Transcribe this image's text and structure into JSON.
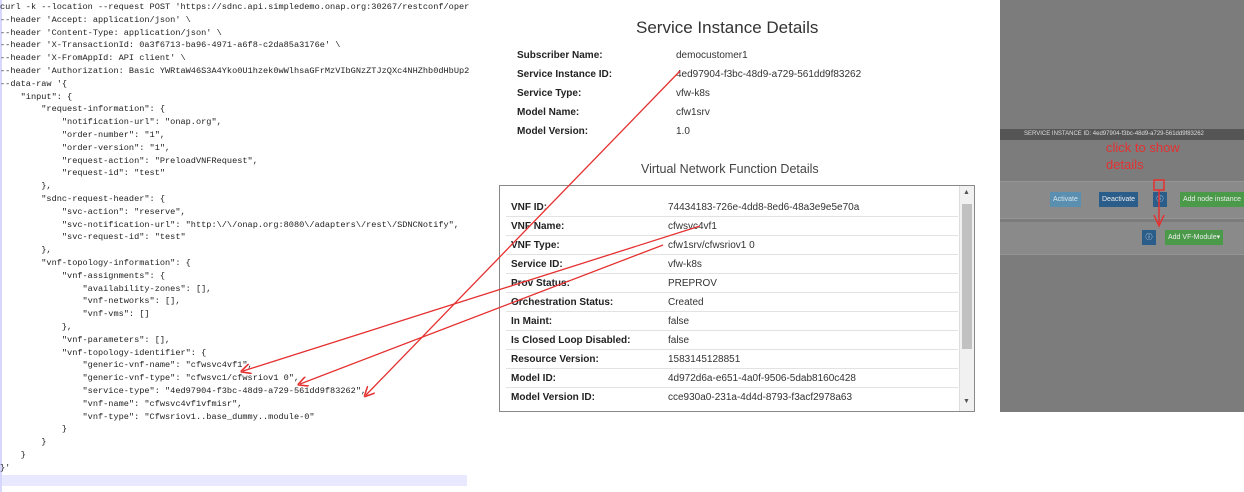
{
  "code_lines": [
    "curl -k --location --request POST 'https://sdnc.api.simpledemo.onap.org:30267/restconf/oper",
    "--header 'Accept: application/json' \\",
    "--header 'Content-Type: application/json' \\",
    "--header 'X-TransactionId: 0a3f6713-ba96-4971-a6f8-c2da85a3176e' \\",
    "--header 'X-FromAppId: API client' \\",
    "--header 'Authorization: Basic YWRtaW46S3A4Yko0U1hzek0wWlhsaGFrMzVIbGNzZTJzQXc4NHZhb0dHbUp2",
    "--data-raw '{",
    "    \"input\": {",
    "        \"request-information\": {",
    "            \"notification-url\": \"onap.org\",",
    "            \"order-number\": \"1\",",
    "            \"order-version\": \"1\",",
    "            \"request-action\": \"PreloadVNFRequest\",",
    "            \"request-id\": \"test\"",
    "        },",
    "        \"sdnc-request-header\": {",
    "            \"svc-action\": \"reserve\",",
    "            \"svc-notification-url\": \"http:\\/\\/onap.org:8080\\/adapters\\/rest\\/SDNCNotify\",",
    "            \"svc-request-id\": \"test\"",
    "        },",
    "        \"vnf-topology-information\": {",
    "            \"vnf-assignments\": {",
    "                \"availability-zones\": [],",
    "                \"vnf-networks\": [],",
    "                \"vnf-vms\": []",
    "            },",
    "            \"vnf-parameters\": [],",
    "            \"vnf-topology-identifier\": {",
    "                \"generic-vnf-name\": \"cfwsvc4vf1\",",
    "                \"generic-vnf-type\": \"cfwsvc1/cfwsriov1 0\",",
    "                \"service-type\": \"4ed97904-f3bc-48d9-a729-561dd9f83262\",",
    "                \"vnf-name\": \"cfwsvc4vf1vfmisr\",",
    "                \"vnf-type\": \"Cfwsriov1..base_dummy..module-0\"",
    "            }",
    "        }",
    "    }",
    "}'",
    ""
  ],
  "service_instance": {
    "title": "Service Instance Details",
    "fields": [
      {
        "label": "Subscriber Name:",
        "value": "democustomer1"
      },
      {
        "label": "Service Instance ID:",
        "value": "4ed97904-f3bc-48d9-a729-561dd9f83262"
      },
      {
        "label": "Service Type:",
        "value": "vfw-k8s"
      },
      {
        "label": "Model Name:",
        "value": "cfw1srv"
      },
      {
        "label": "Model Version:",
        "value": "1.0"
      }
    ]
  },
  "vnf_details": {
    "title": "Virtual Network Function Details",
    "fields": [
      {
        "label": "VNF ID:",
        "value": "74434183-726e-4dd8-8ed6-48a3e9e5e70a"
      },
      {
        "label": "VNF Name:",
        "value": "cfwsvc4vf1"
      },
      {
        "label": "VNF Type:",
        "value": "cfw1srv/cfwsriov1 0"
      },
      {
        "label": "Service ID:",
        "value": "vfw-k8s"
      },
      {
        "label": "Prov Status:",
        "value": "PREPROV"
      },
      {
        "label": "Orchestration Status:",
        "value": "Created"
      },
      {
        "label": "In Maint:",
        "value": "false"
      },
      {
        "label": "Is Closed Loop Disabled:",
        "value": "false"
      },
      {
        "label": "Resource Version:",
        "value": "1583145128851"
      },
      {
        "label": "Model ID:",
        "value": "4d972d6a-e651-4a0f-9506-5dab8160c428"
      },
      {
        "label": "Model Version ID:",
        "value": "cce930a0-231a-4d4d-8793-f3acf2978a63"
      }
    ]
  },
  "right_panel": {
    "header": "SERVICE INSTANCE ID: 4ed97904-f3bc-48d9-a729-561dd9f83262",
    "note": "click to show details",
    "buttons": {
      "activate": "Activate",
      "deactivate": "Deactivate",
      "add_node": "Add node instance",
      "add_vf_module": "Add VF-Module▾"
    }
  },
  "colors": {
    "annotation_red": "#e53030",
    "activate_btn": "#5a8fb0",
    "deactivate_btn": "#2b5d8a",
    "add_btn": "#4a9a4a",
    "info_btn": "#2b5d8a"
  }
}
